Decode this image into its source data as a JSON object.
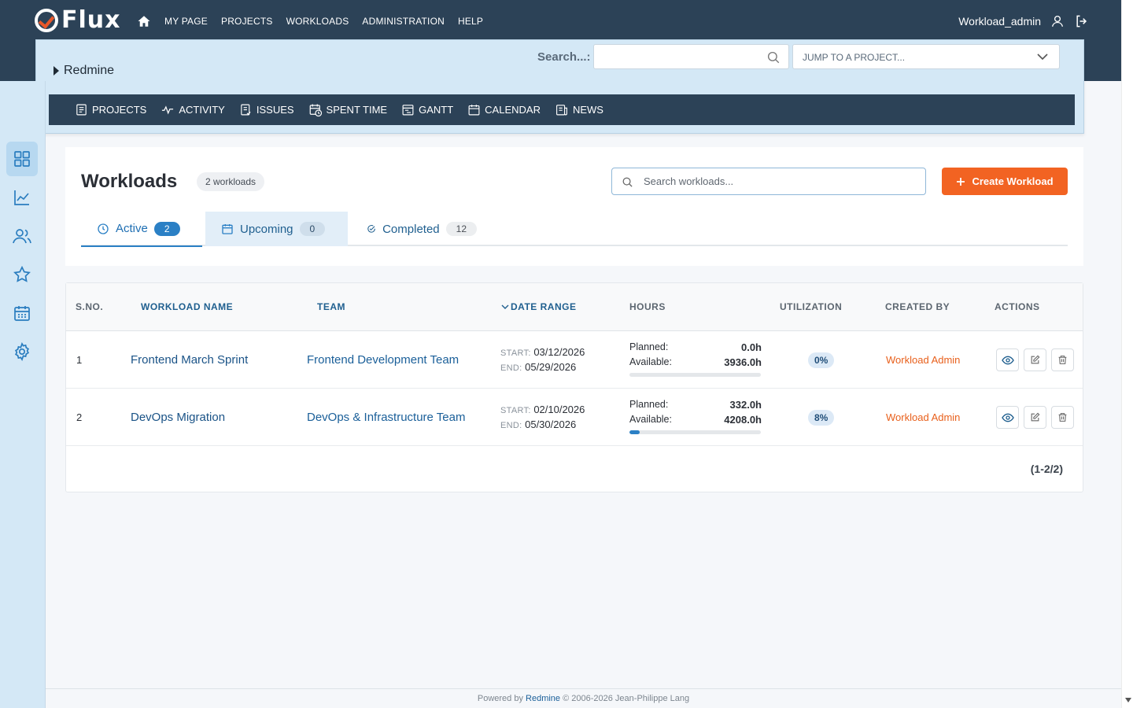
{
  "app": {
    "logo_text": "Flux",
    "accent_color": "#f26322",
    "header_color": "#2c4257"
  },
  "topnav": {
    "items": [
      {
        "label": "MY PAGE"
      },
      {
        "label": "PROJECTS"
      },
      {
        "label": "WORKLOADS"
      },
      {
        "label": "ADMINISTRATION"
      },
      {
        "label": "HELP"
      }
    ],
    "username": "Workload_admin"
  },
  "project": {
    "name": "Redmine",
    "search_label": "Search...:",
    "search_value": "",
    "jump_placeholder": "JUMP TO A PROJECT...",
    "menu": [
      {
        "label": "PROJECTS",
        "icon": "projects-icon"
      },
      {
        "label": "ACTIVITY",
        "icon": "activity-icon"
      },
      {
        "label": "ISSUES",
        "icon": "issues-icon"
      },
      {
        "label": "SPENT TIME",
        "icon": "spent-time-icon"
      },
      {
        "label": "GANTT",
        "icon": "gantt-icon"
      },
      {
        "label": "CALENDAR",
        "icon": "calendar-icon"
      },
      {
        "label": "NEWS",
        "icon": "news-icon"
      }
    ]
  },
  "sidebar": {
    "items": [
      {
        "icon": "dashboard-grid-icon",
        "active": true
      },
      {
        "icon": "chart-line-icon"
      },
      {
        "icon": "users-icon"
      },
      {
        "icon": "star-icon"
      },
      {
        "icon": "calendar-icon"
      },
      {
        "icon": "gear-icon"
      }
    ]
  },
  "workloads": {
    "title": "Workloads",
    "count_label": "2 workloads",
    "search_placeholder": "Search workloads...",
    "create_label": "Create Workload",
    "tabs": [
      {
        "label": "Active",
        "count": "2",
        "icon": "clock-icon"
      },
      {
        "label": "Upcoming",
        "count": "0",
        "icon": "calendar-icon"
      },
      {
        "label": "Completed",
        "count": "12",
        "icon": "check-circle-icon"
      }
    ]
  },
  "table": {
    "headers": {
      "sno": "S.NO.",
      "name": "WORKLOAD NAME",
      "team": "TEAM",
      "date_range": "DATE RANGE",
      "hours": "HOURS",
      "utilization": "UTILIZATION",
      "created_by": "CREATED BY",
      "actions": "ACTIONS"
    },
    "start_label": "START:",
    "end_label": "END:",
    "planned_label": "Planned:",
    "available_label": "Available:",
    "rows": [
      {
        "sno": "1",
        "name": "Frontend March Sprint",
        "team": "Frontend Development Team",
        "start": "03/12/2026",
        "end": "05/29/2026",
        "planned": "0.0h",
        "available": "3936.0h",
        "utilization": "0%",
        "utilization_fraction": 0.0,
        "created_by": "Workload Admin"
      },
      {
        "sno": "2",
        "name": "DevOps Migration",
        "team": "DevOps & Infrastructure Team",
        "start": "02/10/2026",
        "end": "05/30/2026",
        "planned": "332.0h",
        "available": "4208.0h",
        "utilization": "8%",
        "utilization_fraction": 0.08,
        "created_by": "Workload Admin"
      }
    ],
    "pagination": "(1-2/2)"
  },
  "footer": {
    "prefix": "Powered by",
    "link": "Redmine",
    "suffix": "© 2006-2026 Jean-Philippe Lang"
  }
}
